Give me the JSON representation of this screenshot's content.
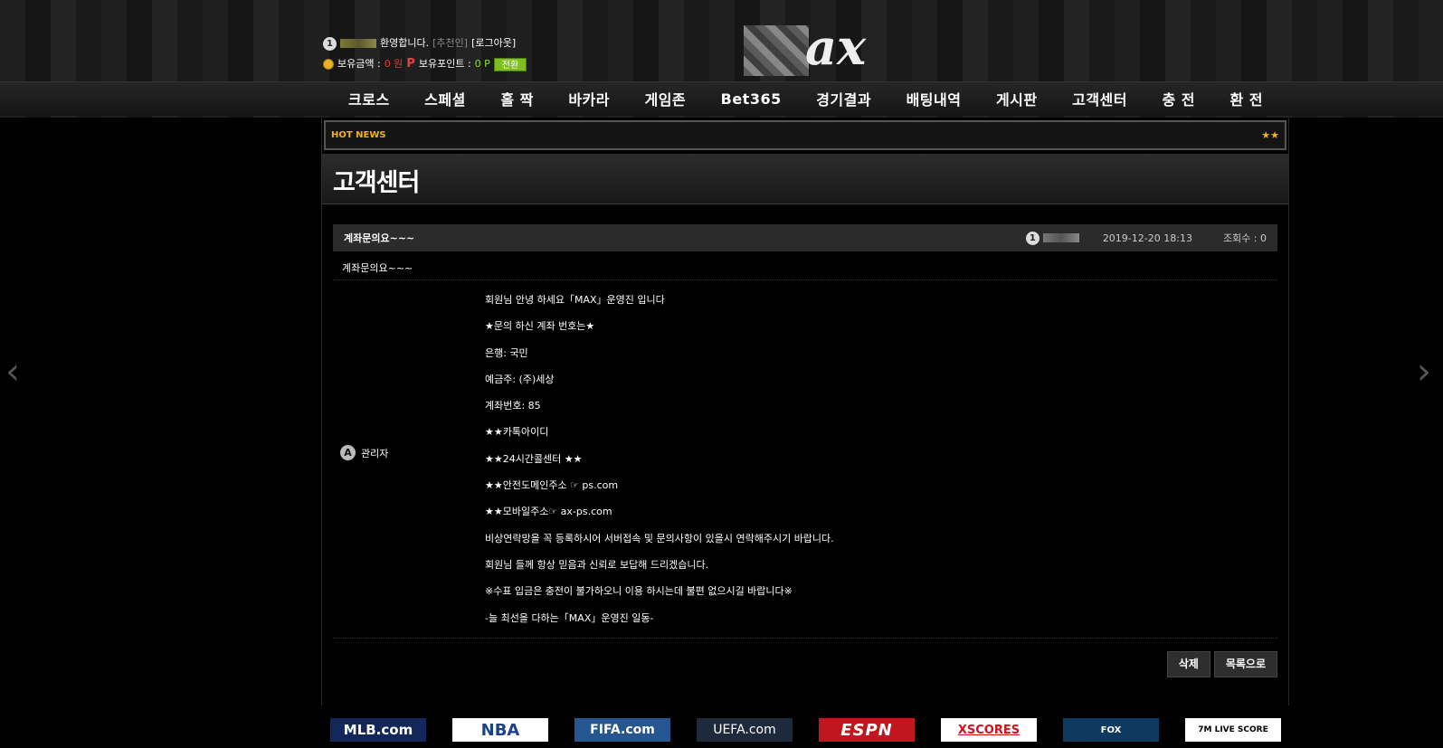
{
  "header": {
    "welcome": "환영합니다.",
    "recommender": "[추천인]",
    "logout": "[로그아웃]",
    "money_label": "보유금액 :",
    "money_value": "0 원",
    "point_label": "보유포인트 :",
    "point_value": "0 P",
    "convert_label": "전환",
    "level_badge": "1",
    "point_icon": "P",
    "logo_text": "ax"
  },
  "nav": [
    "크로스",
    "스페셜",
    "홀 짝",
    "바카라",
    "게임존",
    "Bet365",
    "경기결과",
    "배팅내역",
    "게시판",
    "고객센터",
    "충 전",
    "환 전"
  ],
  "hotnews": {
    "label": "HOT NEWS",
    "stars": "★★"
  },
  "page_title": "고객센터",
  "post": {
    "subject": "계좌문의요~~~",
    "author_level": "1",
    "date": "2019-12-20 18:13",
    "hits": "조회수 : 0",
    "question": "계좌문의요~~~"
  },
  "answer": {
    "admin_badge": "A",
    "admin_label": "관리자",
    "lines": [
      "회원님 안녕 하세요「MAX」운영진 입니다",
      "★문의 하신 계좌 번호는★",
      "은행: 국민",
      "예금주: (주)세상",
      "계좌번호: 85",
      "★★카톡아이디",
      "★★24시간콜센터 ★★",
      "★★안전도메인주소 ☞ ps.com",
      "★★모바일주소☞ ax-ps.com",
      "비상연락망을 꼭 등록하시어 서버접속 및 문의사항이 있을시 연락해주시기 바랍니다.",
      "회원님 들께 항상 믿음과 신뢰로 보답해 드리겠습니다.",
      "※수표 입금은 충전이 불가하오니 이용 하시는데 불편 없으시길 바랍니다※",
      "-늘 최선을 다하는「MAX」운영진 일동-"
    ]
  },
  "buttons": {
    "delete": "삭제",
    "list": "목록으로"
  },
  "sponsors": [
    "MLB.com",
    "NBA",
    "FIFA.com",
    "UEFA.com",
    "ESPN",
    "XSCORES",
    "FOX",
    "7M LIVE SCORE"
  ],
  "arrows": {
    "left": "‹",
    "right": "›"
  }
}
